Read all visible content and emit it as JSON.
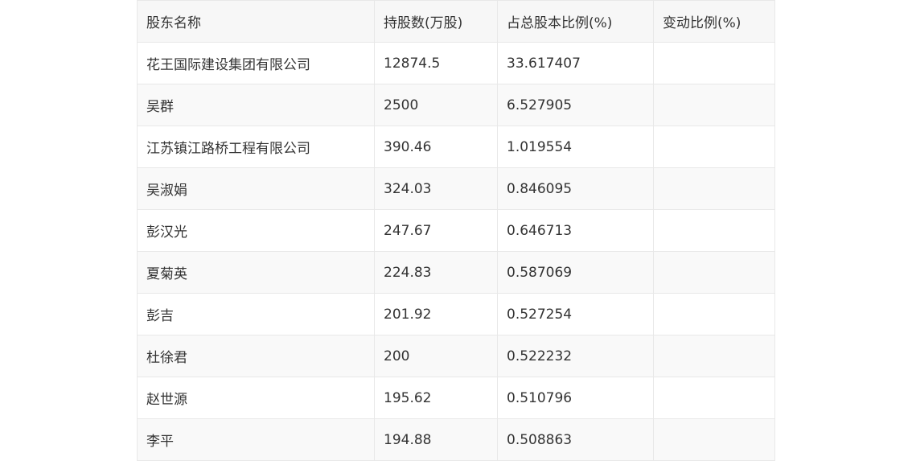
{
  "table": {
    "headers": [
      "股东名称",
      "持股数(万股)",
      "占总股本比例(%)",
      "变动比例(%)"
    ],
    "rows": [
      [
        "花王国际建设集团有限公司",
        "12874.5",
        "33.617407",
        ""
      ],
      [
        "吴群",
        "2500",
        "6.527905",
        ""
      ],
      [
        "江苏镇江路桥工程有限公司",
        "390.46",
        "1.019554",
        ""
      ],
      [
        "吴淑娟",
        "324.03",
        "0.846095",
        ""
      ],
      [
        "彭汉光",
        "247.67",
        "0.646713",
        ""
      ],
      [
        "夏菊英",
        "224.83",
        "0.587069",
        ""
      ],
      [
        "彭吉",
        "201.92",
        "0.527254",
        ""
      ],
      [
        "杜徐君",
        "200",
        "0.522232",
        ""
      ],
      [
        "赵世源",
        "195.62",
        "0.510796",
        ""
      ],
      [
        "李平",
        "194.88",
        "0.508863",
        ""
      ]
    ]
  }
}
